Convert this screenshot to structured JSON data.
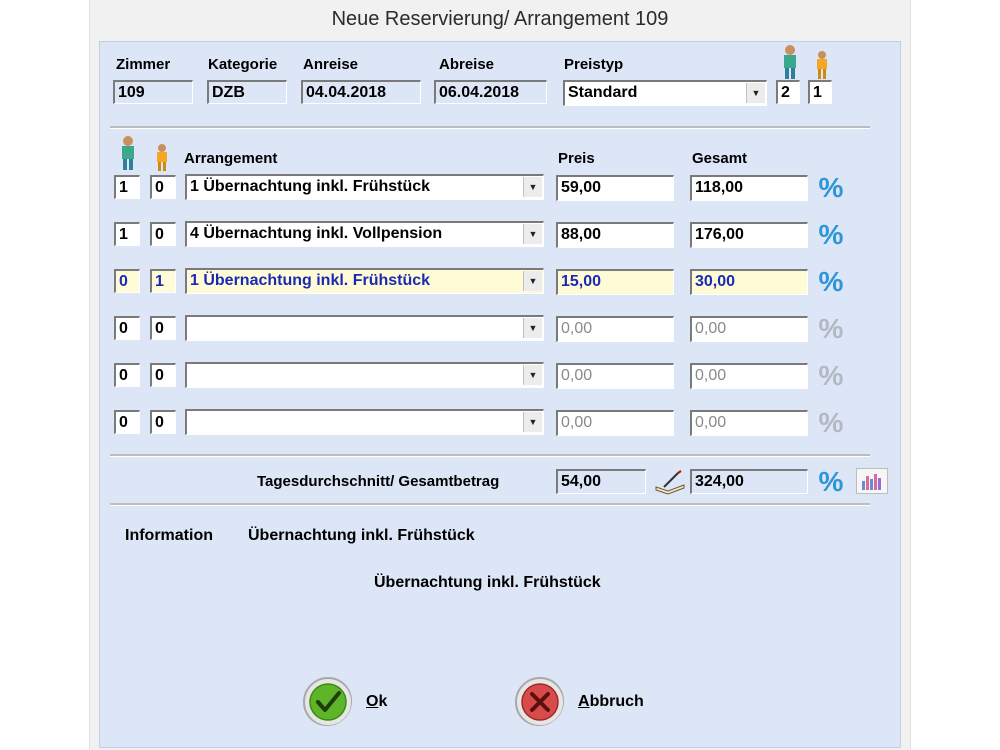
{
  "title": "Neue Reservierung/ Arrangement 109",
  "header": {
    "zimmer_label": "Zimmer",
    "zimmer": "109",
    "kategorie_label": "Kategorie",
    "kategorie": "DZB",
    "anreise_label": "Anreise",
    "anreise": "04.04.2018",
    "abreise_label": "Abreise",
    "abreise": "06.04.2018",
    "preistyp_label": "Preistyp",
    "preistyp": "Standard",
    "adults": "2",
    "children": "1"
  },
  "columns": {
    "arrangement": "Arrangement",
    "preis": "Preis",
    "gesamt": "Gesamt"
  },
  "rows": [
    {
      "adults": "1",
      "children": "0",
      "arrangement": "1 Übernachtung inkl. Frühstück",
      "preis": "59,00",
      "gesamt": "118,00"
    },
    {
      "adults": "1",
      "children": "0",
      "arrangement": "4 Übernachtung inkl. Vollpension",
      "preis": "88,00",
      "gesamt": "176,00"
    },
    {
      "adults": "0",
      "children": "1",
      "arrangement": "1 Übernachtung inkl. Frühstück",
      "preis": "15,00",
      "gesamt": "30,00"
    },
    {
      "adults": "0",
      "children": "0",
      "arrangement": "",
      "preis": "0,00",
      "gesamt": "0,00"
    },
    {
      "adults": "0",
      "children": "0",
      "arrangement": "",
      "preis": "0,00",
      "gesamt": "0,00"
    },
    {
      "adults": "0",
      "children": "0",
      "arrangement": "",
      "preis": "0,00",
      "gesamt": "0,00"
    }
  ],
  "summary": {
    "label": "Tagesdurchschnitt/ Gesamtbetrag",
    "average": "54,00",
    "total": "324,00"
  },
  "info": {
    "label": "Information",
    "value": "Übernachtung inkl. Frühstück",
    "detail": "Übernachtung inkl. Frühstück"
  },
  "buttons": {
    "ok_mnemonic": "O",
    "ok_rest": "k",
    "cancel_mnemonic": "A",
    "cancel_rest": "bbruch"
  },
  "icons": {
    "percent": "percent-icon",
    "adult": "adult-person-icon",
    "child": "child-person-icon",
    "edit": "pen-book-icon",
    "chart": "bar-chart-icon",
    "ok": "checkmark-icon",
    "cancel": "x-icon"
  },
  "colors": {
    "highlight_row": "#fffbd6",
    "highlight_text": "#1a2ab5",
    "percent_active": "#2c96d6",
    "ok_green": "#5fb52a",
    "cancel_red": "#d84b4b"
  }
}
